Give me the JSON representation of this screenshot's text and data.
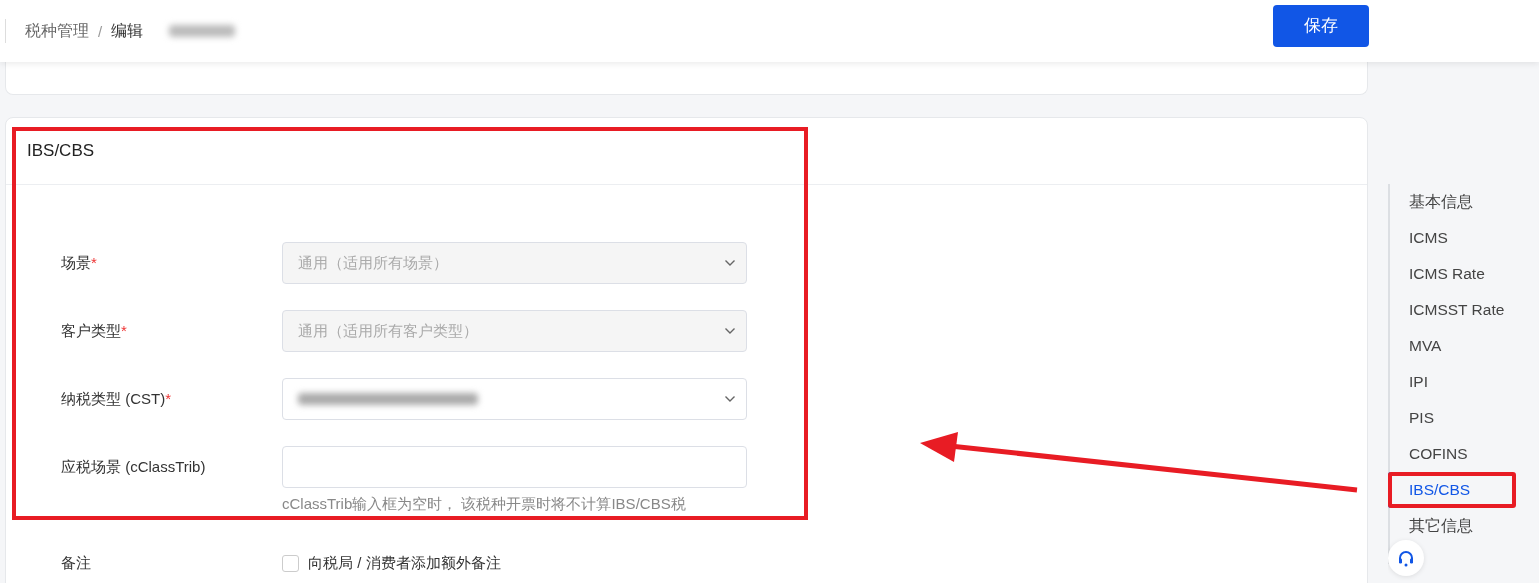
{
  "header": {
    "breadcrumb": [
      "税种管理",
      "编辑"
    ],
    "separator": "/",
    "id_redacted": true,
    "save_button": "保存"
  },
  "section": {
    "title": "IBS/CBS",
    "highlighted": true,
    "fields": [
      {
        "kind": "select",
        "label": "场景",
        "required_mark": "*",
        "value": "通用（适用所有场景）",
        "disabled": true
      },
      {
        "kind": "select",
        "label": "客户类型",
        "required_mark": "*",
        "value": "通用（适用所有客户类型）",
        "disabled": true
      },
      {
        "kind": "select",
        "label": "纳税类型 (CST)",
        "required_mark": "*",
        "value_redacted": true
      },
      {
        "kind": "input",
        "label": "应税场景 (cClassTrib)",
        "hint": "cClassTrib输入框为空时， 该税种开票时将不计算IBS/CBS税"
      }
    ],
    "remark": {
      "label": "备注",
      "checkbox_label": "向税局 / 消费者添加额外备注",
      "checked": false
    }
  },
  "nav": {
    "items": [
      {
        "label": "基本信息",
        "selected": false,
        "highlighted": false
      },
      {
        "label": "ICMS",
        "selected": false,
        "highlighted": false
      },
      {
        "label": "ICMS Rate",
        "selected": false,
        "highlighted": false
      },
      {
        "label": "ICMSST Rate",
        "selected": false,
        "highlighted": false
      },
      {
        "label": "MVA",
        "selected": false,
        "highlighted": false
      },
      {
        "label": "IPI",
        "selected": false,
        "highlighted": false
      },
      {
        "label": "PIS",
        "selected": false,
        "highlighted": false
      },
      {
        "label": "COFINS",
        "selected": false,
        "highlighted": false
      },
      {
        "label": "IBS/CBS",
        "selected": true,
        "highlighted": true
      },
      {
        "label": "其它信息",
        "selected": false,
        "highlighted": false
      }
    ]
  },
  "annotation_arrow": true
}
